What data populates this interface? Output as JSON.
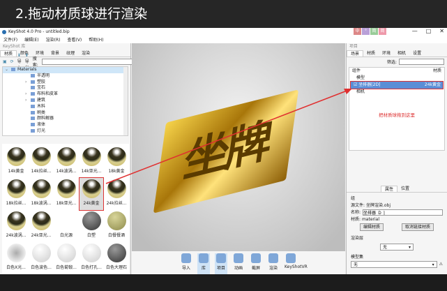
{
  "banner": {
    "title": "2.拖动材质球进行渲染"
  },
  "window": {
    "title": "KeyShot 4.0 Pro  - untitled.bip",
    "ime": [
      "中",
      "°",
      "简",
      "简"
    ],
    "controls": [
      "—",
      "□",
      "✕"
    ],
    "menu": [
      "文件(F)",
      "编辑(E)",
      "渲染(R)",
      "查看(V)",
      "帮助(H)"
    ]
  },
  "library": {
    "title": "KeyShot 库",
    "tabs": [
      "材质",
      "颜色",
      "环境",
      "背景",
      "纹理",
      "渲染"
    ],
    "import": "导入",
    "export": "导出",
    "search_label": "搜索:",
    "search_value": "",
    "tree": {
      "root": "Materials",
      "items": [
        {
          "label": "半透明",
          "exp": false
        },
        {
          "label": "塑胶",
          "exp": true
        },
        {
          "label": "宝石",
          "exp": false
        },
        {
          "label": "布料和皮革",
          "exp": true
        },
        {
          "label": "建筑",
          "exp": true
        },
        {
          "label": "木料",
          "exp": false
        },
        {
          "label": "刷类",
          "exp": false
        },
        {
          "label": "颜料解器",
          "exp": false
        },
        {
          "label": "液体",
          "exp": false
        },
        {
          "label": "灯光",
          "exp": false
        }
      ]
    },
    "materials": [
      {
        "label": "14k黄金",
        "t": "gold"
      },
      {
        "label": "14k拉丝...",
        "t": "gold"
      },
      {
        "label": "14k波涡...",
        "t": "gold"
      },
      {
        "label": "14k亚光...",
        "t": "gold"
      },
      {
        "label": "18k黄金",
        "t": "gold"
      },
      {
        "label": "18k拉丝...",
        "t": "gold"
      },
      {
        "label": "18k波涡...",
        "t": "gold"
      },
      {
        "label": "18k亚光...",
        "t": "gold"
      },
      {
        "label": "24k黄金",
        "t": "gold",
        "selected": true
      },
      {
        "label": "24k拉丝...",
        "t": "gold"
      },
      {
        "label": "24k波涡...",
        "t": "gold"
      },
      {
        "label": "24k亚光...",
        "t": "gold"
      },
      {
        "label": "白光源",
        "t": "none"
      },
      {
        "label": "白塑",
        "t": "grey"
      },
      {
        "label": "白餐餐酒",
        "t": "olive"
      },
      {
        "label": "白色X光...",
        "t": "soft"
      },
      {
        "label": "白色波色...",
        "t": "white"
      },
      {
        "label": "白色菊锻...",
        "t": "white"
      },
      {
        "label": "白色打孔...",
        "t": "white"
      },
      {
        "label": "白色大理石",
        "t": "grey"
      }
    ]
  },
  "viewport": {
    "object_text": "坐牌"
  },
  "toolbar": [
    "导入",
    "库",
    "项目",
    "动画",
    "截屏",
    "渲染",
    "KeyShotVR"
  ],
  "project": {
    "title": "项目",
    "tabs": [
      "场景",
      "材质",
      "环境",
      "相机",
      "设置"
    ],
    "filter_label": "筛选:",
    "col_component": "组件",
    "col_material": "材质",
    "model": "模型",
    "row_name": "坐排器[2D]",
    "row_material": "24k黄金",
    "camera": "相机",
    "annotation": "把材质球拖到这里",
    "prop_tabs": [
      "属性",
      "位置"
    ],
    "group": "组",
    "source_label": "源文件:",
    "source_value": "坐牌渲染.obj",
    "name_label": "名称:",
    "name_value": "坐排器  D  ]",
    "material_label": "材质:",
    "material_value": "material",
    "edit_btn": "编辑材质",
    "unlink_btn": "取消链接材质",
    "render_layer": "渲染层",
    "render_layer_value": "无",
    "model_set": "模型集",
    "model_set_value": "无"
  }
}
